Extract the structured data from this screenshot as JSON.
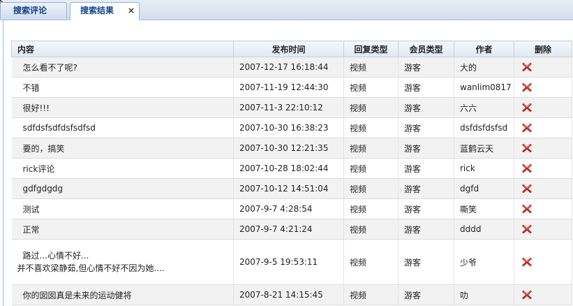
{
  "tabs": [
    {
      "label": "搜索评论",
      "active": false
    },
    {
      "label": "搜索结果",
      "active": true,
      "close_glyph": "×"
    }
  ],
  "grid": {
    "columns": [
      "内容",
      "发布时间",
      "回复类型",
      "会员类型",
      "作者",
      "删除"
    ],
    "rows": [
      {
        "content": "怎么看不了呢?",
        "time": "2007-12-17 16:18:44",
        "reply_type": "视频",
        "member_type": "游客",
        "author": "大的"
      },
      {
        "content": "不错",
        "time": "2007-11-19 12:44:30",
        "reply_type": "视频",
        "member_type": "游客",
        "author": "wanlim0817"
      },
      {
        "content": "很好!!!",
        "time": "2007-11-3 22:10:12",
        "reply_type": "视频",
        "member_type": "游客",
        "author": "六六"
      },
      {
        "content": "sdfdsfsdfdsfsdfsd",
        "time": "2007-10-30 16:38:23",
        "reply_type": "视频",
        "member_type": "游客",
        "author": "dsfdsfdsfsd"
      },
      {
        "content": "要的，搞笑",
        "time": "2007-10-30 12:21:35",
        "reply_type": "视频",
        "member_type": "游客",
        "author": "蓝鹤云天"
      },
      {
        "content": "rick评论",
        "time": "2007-10-28 18:02:44",
        "reply_type": "视频",
        "member_type": "游客",
        "author": "rick"
      },
      {
        "content": "gdfgdgdg",
        "time": "2007-10-12 14:51:04",
        "reply_type": "视频",
        "member_type": "游客",
        "author": "dgfd"
      },
      {
        "content": "测试",
        "time": "2007-9-7 4:28:54",
        "reply_type": "视频",
        "member_type": "游客",
        "author": "嘶笑"
      },
      {
        "content": "正常",
        "time": "2007-9-7 4:21:24",
        "reply_type": "视频",
        "member_type": "游客",
        "author": "dddd"
      },
      {
        "content_lines": [
          "路过...心情不好...",
          "并不喜欢梁静茹,但心情不好不因为她...."
        ],
        "time": "2007-9-5 19:53:11",
        "reply_type": "视频",
        "member_type": "游客",
        "author": "少爷"
      },
      {
        "content": "你的囡囡真是未来的运动健将",
        "time": "2007-8-21 14:15:45",
        "reply_type": "视频",
        "member_type": "游客",
        "author": "叻"
      }
    ]
  },
  "icons": {
    "delete": "delete-x-icon"
  },
  "colors": {
    "tab_text": "#15428b",
    "tab_border": "#8db2e3",
    "delete_red": "#d42b1e",
    "row_alt": "#f2f2f2"
  }
}
